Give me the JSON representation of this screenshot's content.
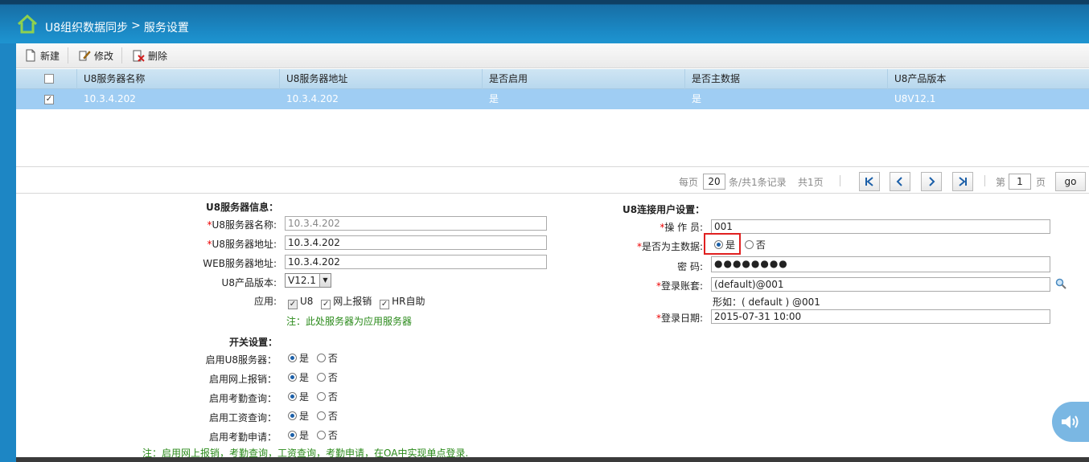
{
  "header": {
    "module": "U8组织数据同步",
    "separator": ">",
    "page": "服务设置",
    "home_icon": "home-icon"
  },
  "toolbar": {
    "new_label": "新建",
    "edit_label": "修改",
    "delete_label": "删除"
  },
  "grid": {
    "headers": [
      "U8服务器名称",
      "U8服务器地址",
      "是否启用",
      "是否主数据",
      "U8产品版本"
    ],
    "header_checked": "",
    "rows": [
      {
        "checked": "✓",
        "name": "10.3.4.202",
        "address": "10.3.4.202",
        "enabled": "是",
        "is_master": "是",
        "version": "U8V12.1"
      }
    ]
  },
  "pager": {
    "per_page_label": "每页",
    "per_page": "20",
    "records_text": "条/共1条记录",
    "total_pages": "共1页",
    "page_label": "第",
    "page": "1",
    "page_unit": "页",
    "go_label": "go",
    "first_icon": "K",
    "prev_icon": "<",
    "next_icon": ">",
    "last_icon": ">|"
  },
  "server_info": {
    "title": "U8服务器信息：",
    "name_label": "U8服务器名称:",
    "name_value": "10.3.4.202",
    "address_label": "U8服务器地址:",
    "address_value": "10.3.4.202",
    "web_label": "WEB服务器地址:",
    "web_value": "10.3.4.202",
    "version_label": "U8产品版本:",
    "version_value": "V12.1",
    "app_label": "应用:",
    "app_u8": "U8",
    "app_reimburse": "网上报销",
    "app_hr": "HR自助",
    "app_check": "✓",
    "note": "注：此处服务器为应用服务器"
  },
  "switch_settings": {
    "title": "开关设置：",
    "yes": "是",
    "no": "否",
    "items": [
      {
        "label": "启用U8服务器："
      },
      {
        "label": "启用网上报销："
      },
      {
        "label": "启用考勤查询："
      },
      {
        "label": "启用工资查询："
      },
      {
        "label": "启用考勤申请："
      }
    ],
    "note": "注：启用网上报销，考勤查询，工资查询，考勤申请，在OA中实现单点登录."
  },
  "user_settings": {
    "title": "U8连接用户设置：",
    "operator_label": "操 作 员:",
    "operator_value": "001",
    "master_label": "是否为主数据:",
    "master_yes": "是",
    "master_no": "否",
    "password_label": "密 码:",
    "password_value": "●●●●●●●●",
    "account_label": "登录账套:",
    "account_value": "(default)@001",
    "account_hint": "形如：( default ) @001",
    "date_label": "登录日期:",
    "date_value": "2015-07-31 10:00",
    "required_mark": "*"
  },
  "colors": {
    "header_blue": "#1b8ac6",
    "selected_row": "#9fcdf3",
    "accent_red": "#e02020",
    "note_green": "#2a8a1a"
  }
}
